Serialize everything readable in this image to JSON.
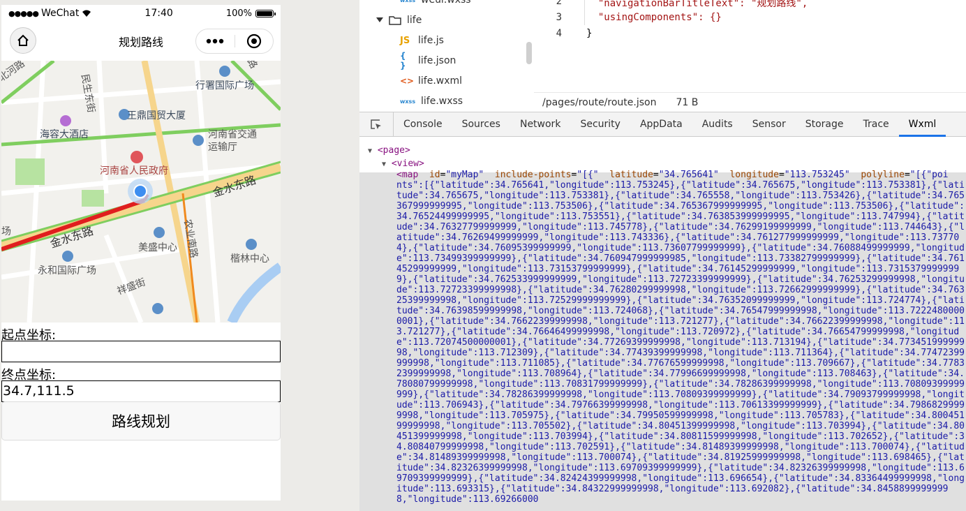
{
  "simulator": {
    "status": {
      "carrier": "WeChat",
      "time": "17:40",
      "battery": "100%"
    },
    "nav_title": "规划路线",
    "map": {
      "labels": [
        "民生东街",
        "行署国际广场",
        "王鼎国贸大厦",
        "海容大酒店",
        "河南省交通",
        "运输厅",
        "河南省人民政府",
        "金水东路",
        "金水东路",
        "农业南路",
        "美盛中心",
        "楷林中心",
        "永和国际广场",
        "祥盛街",
        "场",
        "北河路",
        "路"
      ]
    },
    "form": {
      "start_label": "起点坐标:",
      "start_value": "",
      "end_label": "终点坐标:",
      "end_value": "34.7,111.5",
      "submit_label": "路线规划"
    }
  },
  "file_tree": {
    "items": [
      {
        "name": "weui.wxss",
        "type": "wxss"
      },
      {
        "name": "life",
        "type": "folder"
      },
      {
        "name": "life.js",
        "type": "js"
      },
      {
        "name": "life.json",
        "type": "json"
      },
      {
        "name": "life.wxml",
        "type": "wxml"
      },
      {
        "name": "life.wxss",
        "type": "wxss"
      }
    ]
  },
  "editor": {
    "lines": [
      {
        "no": "2",
        "text": "  \"navigationBarTitleText\": \"规划路线\","
      },
      {
        "no": "3",
        "text": "  \"usingComponents\": {}"
      },
      {
        "no": "4",
        "text": "}"
      }
    ],
    "path": "/pages/route/route.json",
    "size": "71 B"
  },
  "devtools": {
    "tabs": [
      "Console",
      "Sources",
      "Network",
      "Security",
      "AppData",
      "Audits",
      "Sensor",
      "Storage",
      "Trace",
      "Wxml"
    ],
    "active_tab": "Wxml",
    "wxml": {
      "page_tag": "<page>",
      "view_tag": "<view>",
      "map_tag": "<map",
      "map_id_attr": "id",
      "map_id_val": "\"myMap\"",
      "include_attr": "include-points",
      "include_val": "\"[{\"",
      "lat_attr": "latitude",
      "lat_val": "\"34.765641\"",
      "lng_attr": "longitude",
      "lng_val": "\"113.753245\"",
      "poly_attr": "polyline",
      "poly_val": "\"[{\"poi",
      "polyline_text": "nts\":[{\"latitude\":34.765641,\"longitude\":113.753245},{\"latitude\":34.765675,\"longitude\":113.753381},{\"latitude\":34.765675,\"longitude\":113.753381},{\"latitude\":34.765558,\"longitude\":113.753426},{\"latitude\":34.765367999999995,\"longitude\":113.753506},{\"latitude\":34.765367999999995,\"longitude\":113.753506},{\"latitude\":34.76524499999995,\"longitude\":113.753551},{\"latitude\":34.763853999999995,\"longitude\":113.747994},{\"latitude\":34.76327799999999,\"longitude\":113.745778},{\"latitude\":34.76299199999999,\"longitude\":113.744643},{\"latitude\":34.76269499999999,\"longitude\":113.743336},{\"latitude\":34.761277999999999,\"longitude\":113.737704},{\"latitude\":34.76095399999999,\"longitude\":113.73607799999999},{\"latitude\":34.76088499999999,\"longitude\":113.73499399999999},{\"latitude\":34.760947999999985,\"longitude\":113.73382799999999},{\"latitude\":34.76145299999999,\"longitude\":113.73153799999999},{\"latitude\":34.76145299999999,\"longitude\":113.73153799999999},{\"latitude\":34.762533999999999,\"longitude\":113.72723399999999},{\"latitude\":34.76253299999998,\"longitude\":113.72723399999998},{\"latitude\":34.76280299999998,\"longitude\":113.72662999999999},{\"latitude\":34.76325399999998,\"longitude\":113.72529999999999},{\"latitude\":34.76352099999999,\"longitude\":113.724774},{\"latitude\":34.76398599999998,\"longitude\":113.724068},{\"latitude\":34.76547999999998,\"longitude\":113.72224800000001},{\"latitude\":34.76622399999998,\"longitude\":113.721277},{\"latitude\":34.76622399999998,\"longitude\":113.721277},{\"latitude\":34.76646499999998,\"longitude\":113.720972},{\"latitude\":34.76654799999998,\"longitude\":113.72074500000001},{\"latitude\":34.77269399999998,\"longitude\":113.713194},{\"latitude\":34.77345199999998,\"longitude\":113.712309},{\"latitude\":34.77439399999998,\"longitude\":113.711364},{\"latitude\":34.77472399999998,\"longitude\":113.711085},{\"latitude\":34.77676599999998,\"longitude\":113.709667},{\"latitude\":34.77832399999998,\"longitude\":113.708964},{\"latitude\":34.77996699999998,\"longitude\":113.708463},{\"latitude\":34.78080799999998,\"longitude\":113.70831799999999},{\"latitude\":34.78286399999998,\"longitude\":113.70809399999999},{\"latitude\":34.78286399999998,\"longitude\":113.70809399999999},{\"latitude\":34.79093799999998,\"longitude\":113.706943},{\"latitude\":34.79766399999998,\"longitude\":113.70613399999999},{\"latitude\":34.79868299999998,\"longitude\":113.705975},{\"latitude\":34.79950599999998,\"longitude\":113.705783},{\"latitude\":34.80045199999998,\"longitude\":113.705502},{\"latitude\":34.80451399999998,\"longitude\":113.703994},{\"latitude\":34.80451399999998,\"longitude\":113.703994},{\"latitude\":34.80811599999998,\"longitude\":113.702652},{\"latitude\":34.80840799999998,\"longitude\":113.702591},{\"latitude\":34.81489399999998,\"longitude\":113.700074},{\"latitude\":34.81489399999998,\"longitude\":113.700074},{\"latitude\":34.81925999999998,\"longitude\":113.698465},{\"latitude\":34.82326399999998,\"longitude\":113.69709399999999},{\"latitude\":34.82326399999998,\"longitude\":113.69709399999999},{\"latitude\":34.82424399999998,\"longitude\":113.696654},{\"latitude\":34.83364499999998,\"longitude\":113.693315},{\"latitude\":34.84322999999998,\"longitude\":113.692082},{\"latitude\":34.84588999999998,\"longitude\":113.69266000"
    }
  }
}
